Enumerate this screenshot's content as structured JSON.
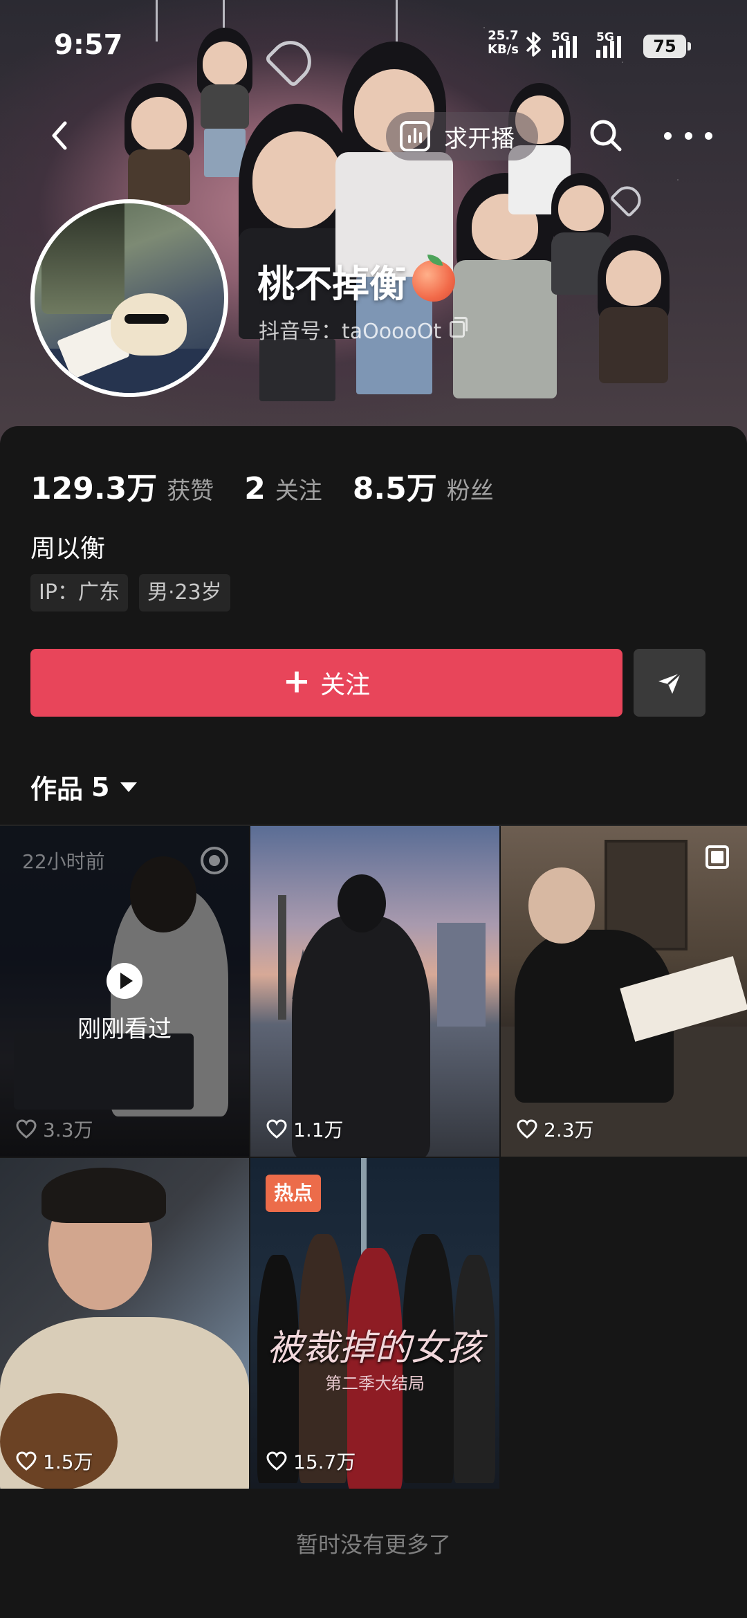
{
  "status_bar": {
    "time": "9:57",
    "net_speed_value": "25.7",
    "net_speed_unit": "KB/s",
    "sim1": "5G",
    "sim2": "5G",
    "battery": "75"
  },
  "nav": {
    "live_request_label": "求开播"
  },
  "profile": {
    "nickname": "桃不掉衡",
    "douyin_id": "抖音号：taOoooOt",
    "stats": [
      {
        "value": "129.3万",
        "label": "获赞"
      },
      {
        "value": "2",
        "label": "关注"
      },
      {
        "value": "8.5万",
        "label": "粉丝"
      }
    ],
    "bio": "周以衡",
    "tags": [
      "IP：广东",
      "男·23岁"
    ]
  },
  "actions": {
    "follow_label": "关注"
  },
  "works": {
    "tab_label": "作品",
    "count": "5",
    "items": [
      {
        "likes": "3.3万",
        "time_ago": "22小时前",
        "watched_label": "刚刚看过"
      },
      {
        "likes": "1.1万"
      },
      {
        "likes": "2.3万"
      },
      {
        "likes": "1.5万"
      },
      {
        "likes": "15.7万",
        "badge": "热点",
        "poster_title": "被裁掉的女孩",
        "poster_subtitle": "第二季大结局"
      }
    ],
    "end_text": "暂时没有更多了"
  },
  "colors": {
    "follow_button": "#e8455a",
    "hot_badge": "#ec6c4a",
    "background": "#161616"
  }
}
